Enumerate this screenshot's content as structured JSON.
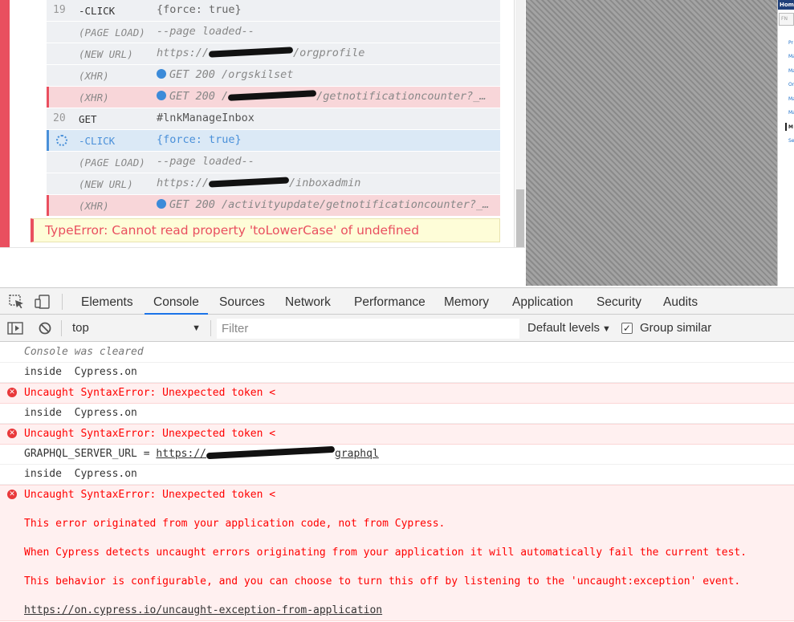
{
  "runner": {
    "commands": [
      {
        "num": "19",
        "name": "-CLICK",
        "msg": "{force: true}",
        "kind": "click",
        "state": "normal"
      },
      {
        "num": "",
        "name": "(PAGE LOAD)",
        "msg": "--page loaded--",
        "kind": "event",
        "state": "normal"
      },
      {
        "num": "",
        "name": "(NEW URL)",
        "msg_prefix": "https://",
        "msg_suffix": "/orgprofile",
        "kind": "event-url",
        "state": "normal"
      },
      {
        "num": "",
        "name": "(XHR)",
        "msg": "GET 200 /orgskilset",
        "kind": "xhr",
        "state": "normal"
      },
      {
        "num": "",
        "name": "(XHR)",
        "msg_prefix": "GET 200 /",
        "msg_suffix": "/getnotificationcounter?_…",
        "kind": "xhr-redacted",
        "state": "error"
      },
      {
        "num": "20",
        "name": "GET",
        "msg": "#lnkManageInbox",
        "kind": "plain",
        "state": "normal"
      },
      {
        "num": "",
        "name": "-CLICK",
        "msg": "{force: true}",
        "kind": "click",
        "state": "pending"
      },
      {
        "num": "",
        "name": "(PAGE LOAD)",
        "msg": "--page loaded--",
        "kind": "event",
        "state": "normal"
      },
      {
        "num": "",
        "name": "(NEW URL)",
        "msg_prefix": "https://",
        "msg_suffix": "/inboxadmin",
        "kind": "event-url",
        "state": "normal"
      },
      {
        "num": "",
        "name": "(XHR)",
        "msg": "GET 200 /activityupdate/getnotificationcounter?_…",
        "kind": "xhr",
        "state": "error"
      }
    ],
    "error_message": "TypeError: Cannot read property 'toLowerCase' of undefined"
  },
  "aut": {
    "header": "Home",
    "sub": "FN",
    "items": [
      "Pr",
      "Ma",
      "Ma",
      "Or",
      "Ma",
      "Ma",
      "M",
      "Se"
    ],
    "active_index": 6
  },
  "devtools": {
    "tabs": [
      "Elements",
      "Console",
      "Sources",
      "Network",
      "Performance",
      "Memory",
      "Application",
      "Security",
      "Audits"
    ],
    "active_tab": "Console",
    "context": "top",
    "filter_placeholder": "Filter",
    "levels": "Default levels",
    "group_similar": "Group similar",
    "messages": [
      {
        "type": "cleared",
        "text": "Console was cleared"
      },
      {
        "type": "log",
        "text": "inside  Cypress.on"
      },
      {
        "type": "error",
        "text": "Uncaught SyntaxError: Unexpected token <"
      },
      {
        "type": "log",
        "text": "inside  Cypress.on"
      },
      {
        "type": "error",
        "text": "Uncaught SyntaxError: Unexpected token <"
      },
      {
        "type": "log-url",
        "text": "GRAPHQL_SERVER_URL = ",
        "url_prefix": "https://",
        "url_suffix": "graphql"
      },
      {
        "type": "log",
        "text": "inside  Cypress.on"
      },
      {
        "type": "error-big",
        "text": "Uncaught SyntaxError: Unexpected token <",
        "lines": [
          "This error originated from your application code, not from Cypress.",
          "When Cypress detects uncaught errors originating from your application it will automatically fail the current test.",
          "This behavior is configurable, and you can choose to turn this off by listening to the 'uncaught:exception' event."
        ],
        "link": "https://on.cypress.io/uncaught-exception-from-application"
      }
    ]
  }
}
